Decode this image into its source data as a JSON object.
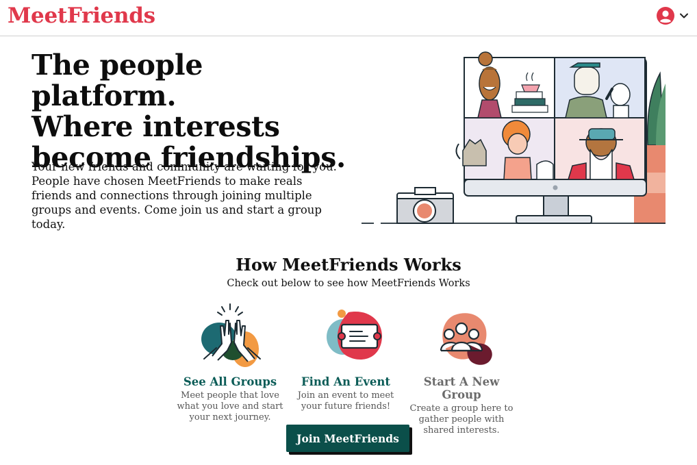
{
  "header": {
    "brand": "MeetFriends",
    "account_icon": "user-circle-icon",
    "menu_icon": "chevron-down-icon"
  },
  "hero": {
    "title_lines": [
      "The people platform.",
      "Where interests",
      "become friendships."
    ],
    "text": "Your new friends and community are waiting for you. People have chosen MeetFriends to make reals friends and connections through joining multiple groups and events. Come join us and start a group today."
  },
  "how": {
    "title": "How MeetFriends Works",
    "subtitle": "Check out below to see how MeetFriends Works",
    "features": [
      {
        "icon": "high-five-icon",
        "title": "See All Groups",
        "desc": "Meet people that love what you love and start your next journey."
      },
      {
        "icon": "ticket-icon",
        "title": "Find An Event",
        "desc": "Join an event to meet your future friends!"
      },
      {
        "icon": "group-people-icon",
        "title": "Start A New Group",
        "desc": "Create a group here to gather people with shared interests."
      }
    ]
  },
  "cta": {
    "label": "Join MeetFriends"
  },
  "colors": {
    "brand": "#e0384b",
    "accent": "#0b5c57",
    "button": "#0b4f4a"
  }
}
